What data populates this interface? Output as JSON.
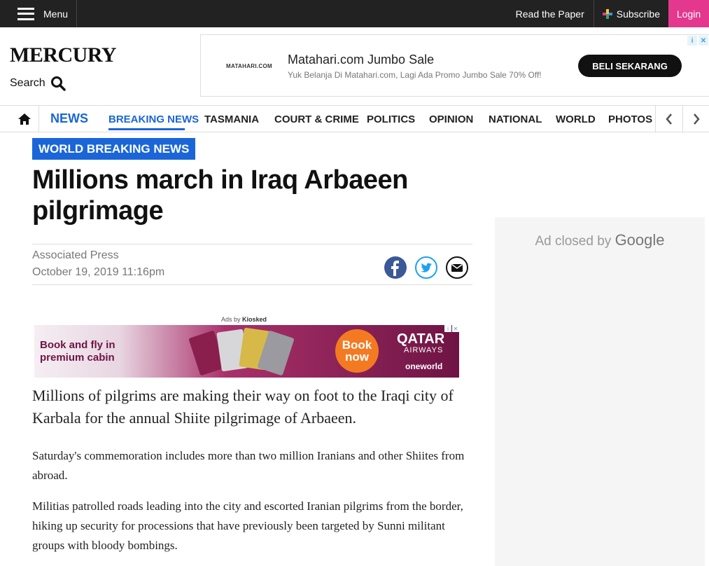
{
  "topbar": {
    "menu_label": "Menu",
    "read_paper": "Read the Paper",
    "subscribe": "Subscribe",
    "login": "Login"
  },
  "header": {
    "logo": "MERCURY",
    "search_label": "Search"
  },
  "top_ad": {
    "brand": "MATAHARI.COM",
    "title": "Matahari.com Jumbo Sale",
    "subtitle": "Yuk Belanja Di Matahari.com, Lagi Ada Promo Jumbo Sale 70% Off!",
    "cta": "BELI SEKARANG"
  },
  "nav": {
    "section": "NEWS",
    "items": [
      "BREAKING NEWS",
      "TASMANIA",
      "COURT & CRIME",
      "POLITICS",
      "OPINION",
      "NATIONAL",
      "WORLD",
      "PHOTOS"
    ],
    "active": "BREAKING NEWS"
  },
  "article": {
    "category": "WORLD BREAKING NEWS",
    "headline": "Millions march in Iraq Arbaeen pilgrimage",
    "author": "Associated Press",
    "date": "October 19, 2019 11:16pm",
    "lede": "Millions of pilgrims are making their way on foot to the Iraqi city of Karbala for the annual Shiite pilgrimage of Arbaeen.",
    "paragraphs": [
      "Saturday's commemoration includes more than two million Iranians and other Shiites from abroad.",
      "Militias patrolled roads leading into the city and escorted Iranian pilgrims from the border, hiking up security for processions that have previously been targeted by Sunni militant groups with bloody bombings."
    ]
  },
  "inline_ad": {
    "ads_by_prefix": "Ads by",
    "ads_by_brand": "Kiosked",
    "tagline": "Book and fly in premium cabin",
    "cta": "Book now",
    "airline": "QATAR",
    "airline_sub": "AIRWAYS",
    "alliance": "oneworld"
  },
  "side_ad": {
    "text": "Ad closed by",
    "brand": "Google"
  },
  "colors": {
    "accent": "#1a66d8",
    "login": "#e4388f",
    "topbar": "#222222"
  }
}
